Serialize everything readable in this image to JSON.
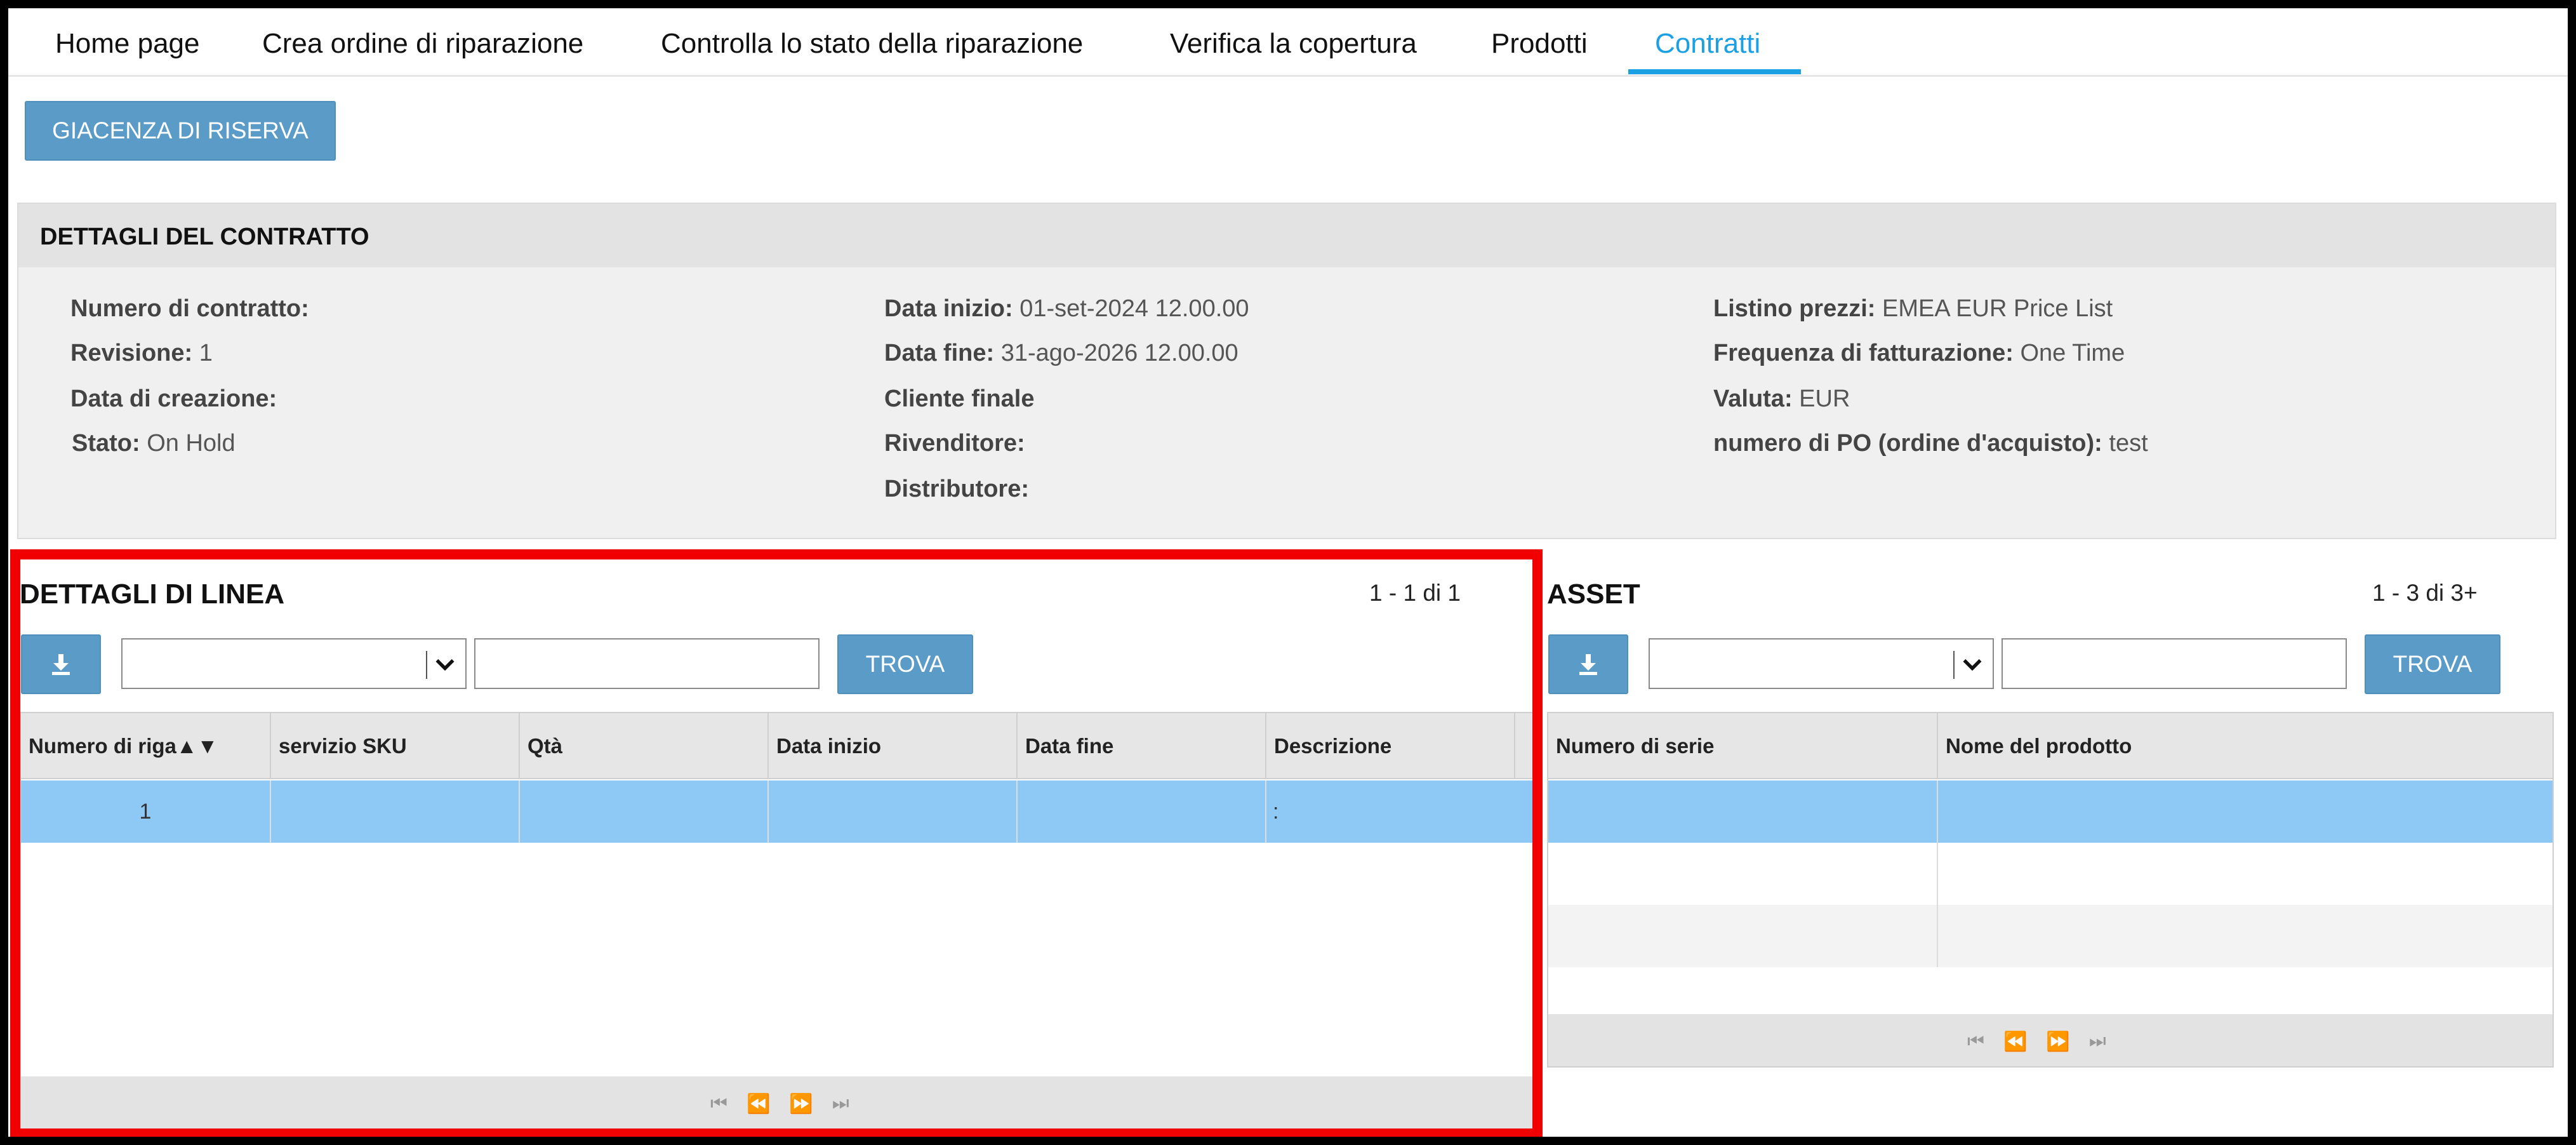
{
  "nav": {
    "tabs": [
      {
        "label": "Home page"
      },
      {
        "label": "Crea ordine di riparazione"
      },
      {
        "label": "Controlla lo stato della riparazione"
      },
      {
        "label": "Verifica la copertura"
      },
      {
        "label": "Prodotti"
      },
      {
        "label": "Contratti",
        "active": true
      }
    ]
  },
  "reserve_button": "GIACENZA DI RISERVA",
  "contract": {
    "title": "DETTAGLI DEL CONTRATTO",
    "fields": {
      "numero_label": "Numero di contratto:",
      "numero_value": "",
      "revisione_label": "Revisione:",
      "revisione_value": "1",
      "creazione_label": "Data di creazione:",
      "creazione_value": "",
      "stato_label": "Stato:",
      "stato_value": "On Hold",
      "inizio_label": "Data inizio:",
      "inizio_value": "01-set-2024 12.00.00",
      "fine_label": "Data fine:",
      "fine_value": "31-ago-2026 12.00.00",
      "cliente_label": "Cliente finale",
      "rivenditore_label": "Rivenditore:",
      "rivenditore_value": "",
      "distributore_label": "Distributore:",
      "distributore_value": "",
      "listino_label": "Listino prezzi:",
      "listino_value": "EMEA EUR Price List",
      "frequenza_label": "Frequenza di fatturazione:",
      "frequenza_value": "One Time",
      "valuta_label": "Valuta:",
      "valuta_value": "EUR",
      "po_label": "numero di PO (ordine d'acquisto):",
      "po_value": "test"
    }
  },
  "lines": {
    "title": "DETTAGLI DI LINEA",
    "count": "1 - 1 di 1",
    "find_button": "TROVA",
    "sort_indicator": "▲▼",
    "columns": [
      "Numero di riga",
      "servizio SKU",
      "Qtà",
      "Data inizio",
      "Data fine",
      "Descrizione"
    ],
    "rows": [
      [
        "1",
        "",
        "",
        "",
        "",
        ":"
      ]
    ]
  },
  "assets": {
    "title": "ASSET",
    "count": "1 - 3 di 3+",
    "find_button": "TROVA",
    "columns": [
      "Numero di serie",
      "Nome del prodotto"
    ],
    "rows": [
      [
        "",
        ""
      ],
      [
        "",
        ""
      ],
      [
        "",
        ""
      ]
    ]
  },
  "icons": {
    "download": "download-icon",
    "chevron": "chevron-down-icon",
    "pager": [
      "first-page-icon",
      "prev-page-icon",
      "next-page-icon",
      "last-page-icon"
    ]
  },
  "colors": {
    "accent": "#1aa0e3",
    "button": "#5b9bc8",
    "selected_row": "#8ec8f5",
    "highlight_box": "#f00000"
  }
}
